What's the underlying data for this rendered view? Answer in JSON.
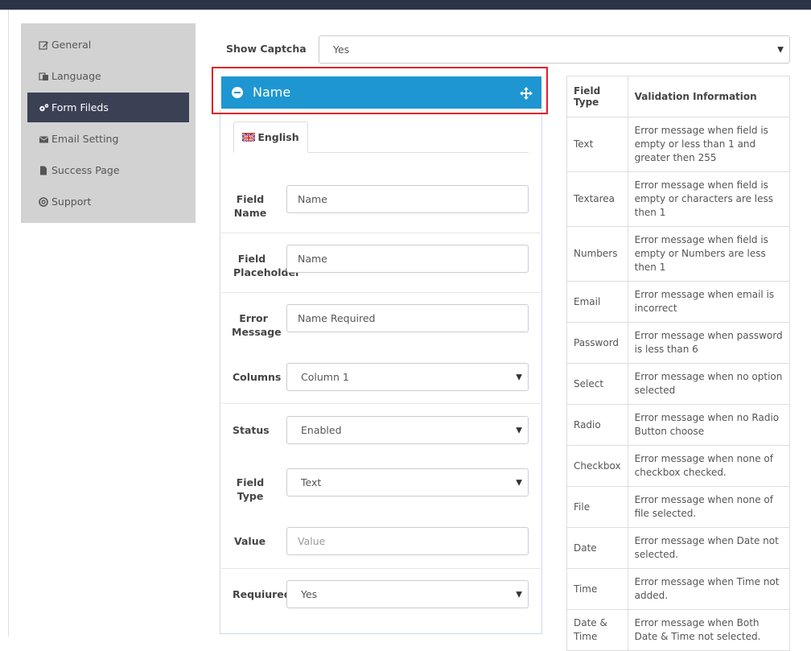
{
  "sidebar": {
    "items": [
      {
        "label": "General",
        "icon": "edit-icon"
      },
      {
        "label": "Language",
        "icon": "language-icon"
      },
      {
        "label": "Form Fileds",
        "icon": "cogs-icon",
        "active": true
      },
      {
        "label": "Email Setting",
        "icon": "envelope-icon"
      },
      {
        "label": "Success Page",
        "icon": "file-icon"
      },
      {
        "label": "Support",
        "icon": "life-ring-icon"
      }
    ]
  },
  "captcha": {
    "label": "Show Captcha",
    "value": "Yes"
  },
  "panel": {
    "title": "Name",
    "tab": "English"
  },
  "form": {
    "field_name": {
      "label_1": "Field",
      "label_2": "Name",
      "value": "Name"
    },
    "field_placeholder": {
      "label_1": "Field",
      "label_2": "Placeholder",
      "value": "Name"
    },
    "error_message": {
      "label_1": "Error",
      "label_2": "Message",
      "value": "Name Required"
    },
    "columns": {
      "label": "Columns",
      "value": "Column 1"
    },
    "status": {
      "label": "Status",
      "value": "Enabled"
    },
    "field_type": {
      "label_1": "Field",
      "label_2": "Type",
      "value": "Text"
    },
    "value": {
      "label": "Value",
      "placeholder": "Value"
    },
    "required": {
      "label": "Requiured",
      "value": "Yes"
    }
  },
  "validation_table": {
    "headers": {
      "type_1": "Field",
      "type_2": "Type",
      "info": "Validation Information"
    },
    "rows": [
      {
        "type": "Text",
        "info": "Error message when field is empty or less than 1 and greater then 255"
      },
      {
        "type": "Textarea",
        "info": "Error message when field is empty or characters are less then 1"
      },
      {
        "type": "Numbers",
        "info": "Error message when field is empty or Numbers are less then 1"
      },
      {
        "type": "Email",
        "info": "Error message when email is incorrect"
      },
      {
        "type": "Password",
        "info": "Error message when password is less than 6"
      },
      {
        "type": "Select",
        "info": "Error message when no option selected"
      },
      {
        "type": "Radio",
        "info": "Error message when no Radio Button choose"
      },
      {
        "type": "Checkbox",
        "info": "Error message when none of checkbox checked."
      },
      {
        "type": "File",
        "info": "Error message when none of file selected."
      },
      {
        "type": "Date",
        "info": "Error message when Date not selected."
      },
      {
        "type": "Time",
        "info": "Error message when Time not added."
      },
      {
        "type": "Date & Time",
        "info": "Error message when Both Date & Time not selected."
      }
    ]
  },
  "colors": {
    "topbar": "#2b3547",
    "active": "#3a4155",
    "panel_header": "#1e96d2",
    "highlight": "#e01f2b"
  }
}
